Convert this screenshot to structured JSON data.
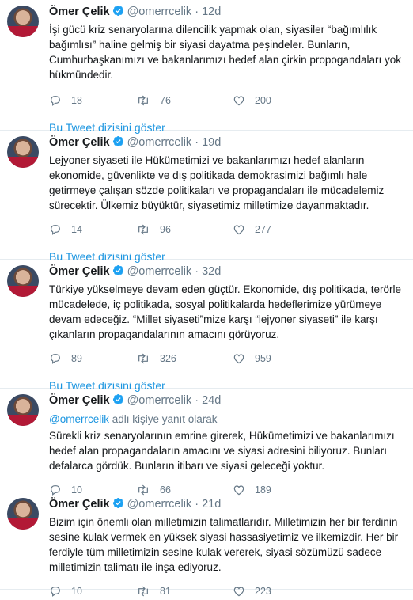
{
  "tweets": [
    {
      "name": "Ömer Çelik",
      "handle": "@omerrcelik",
      "dot": "·",
      "time": "12d",
      "lines": [
        "İşi gücü kriz senaryolarına dilencilik yapmak olan, siyasiler “bağımlılık",
        "bağımlısı” haline gelmiş bir siyasi dayatma peşindeler. Bunların,",
        "Cumhurbaşkanımızı ve bakanlarımızı hedef alan çirkin propogandaları yok",
        "hükmündedir."
      ],
      "replies": "18",
      "retweets": "76",
      "likes": "200",
      "thread_link": "Bu Tweet dizisini göster"
    },
    {
      "name": "Ömer Çelik",
      "handle": "@omerrcelik",
      "dot": "·",
      "time": "19d",
      "lines": [
        "Lejyoner siyaseti ile Hükümetimizi ve bakanlarımızı hedef alanların",
        "ekonomide, güvenlikte ve dış politikada demokrasimizi bağımlı hale",
        "getirmeye çalışan sözde politikaları ve propagandaları ile mücadelemiz",
        "sürecektir. Ülkemiz büyüktür, siyasetimiz milletimize dayanmaktadır."
      ],
      "replies": "14",
      "retweets": "96",
      "likes": "277",
      "thread_link": "Bu Tweet dizisini göster"
    },
    {
      "name": "Ömer Çelik",
      "handle": "@omerrcelik",
      "dot": "·",
      "time": "32d",
      "lines": [
        "Türkiye yükselmeye devam eden güçtür. Ekonomide, dış politikada, terörle",
        "mücadelede, iç politikada, sosyal politikalarda hedeflerimize yürümeye",
        "devam edeceğiz. “Millet siyaseti”mize karşı “lejyoner siyaseti” ile karşı",
        "çıkanların propagandalarının amacını görüyoruz."
      ],
      "replies": "89",
      "retweets": "326",
      "likes": "959",
      "thread_link": "Bu Tweet dizisini göster"
    },
    {
      "name": "Ömer Çelik",
      "handle": "@omerrcelik",
      "dot": "·",
      "time": "24d",
      "reply_mention": "@omerrcelik",
      "reply_suffix": " adlı kişiye yanıt olarak",
      "lines": [
        "Sürekli kriz senaryolarının emrine girerek, Hükümetimizi ve bakanlarımızı",
        "hedef alan propagandaların amacını ve siyasi adresini biliyoruz. Bunları",
        "defalarca gördük. Bunların itibarı ve siyasi geleceği yoktur."
      ],
      "replies": "10",
      "retweets": "66",
      "likes": "189"
    },
    {
      "name": "Ömer Çelik",
      "handle": "@omerrcelik",
      "dot": "·",
      "time": "21d",
      "lines": [
        "Bizim için önemli olan milletimizin talimatlarıdır. Milletimizin her bir ferdinin",
        "sesine kulak vermek en yüksek siyasi hassasiyetimiz ve ilkemizdir. Her bir",
        "ferdiyle tüm milletimizin sesine kulak vererek, siyasi sözümüzü sadece",
        "milletimizin talimatı ile inşa ediyoruz."
      ],
      "replies": "10",
      "retweets": "81",
      "likes": "223"
    }
  ],
  "colors": {
    "link": "#1b95e0",
    "muted": "#657786",
    "verified": "#1da1f2",
    "divider": "#e6ecf0"
  },
  "icons": [
    "reply-icon",
    "retweet-icon",
    "like-icon",
    "verified-badge-icon"
  ]
}
